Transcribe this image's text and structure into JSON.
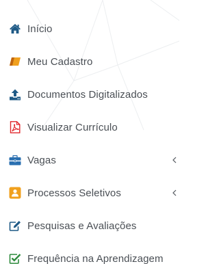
{
  "menu": {
    "items": [
      {
        "label": "Início",
        "icon": "home-icon",
        "color": "#1f5a86",
        "submenu": false
      },
      {
        "label": "Meu Cadastro",
        "icon": "eraser-icon",
        "color": "#f0a01e",
        "submenu": false
      },
      {
        "label": "Documentos Digitalizados",
        "icon": "upload-icon",
        "color": "#1f5a86",
        "submenu": false
      },
      {
        "label": "Visualizar Currículo",
        "icon": "pdf-file-icon",
        "color": "#e0262b",
        "submenu": false
      },
      {
        "label": "Vagas",
        "icon": "briefcase-icon",
        "color": "#2a6fb0",
        "submenu": true
      },
      {
        "label": "Processos Seletivos",
        "icon": "user-badge-icon",
        "color": "#f0a01e",
        "submenu": true
      },
      {
        "label": "Pesquisas e Avaliações",
        "icon": "edit-icon",
        "color": "#1f5a86",
        "submenu": false
      },
      {
        "label": "Frequência na Aprendizagem",
        "icon": "check-square-icon",
        "color": "#2e8b3d",
        "submenu": false
      }
    ]
  }
}
